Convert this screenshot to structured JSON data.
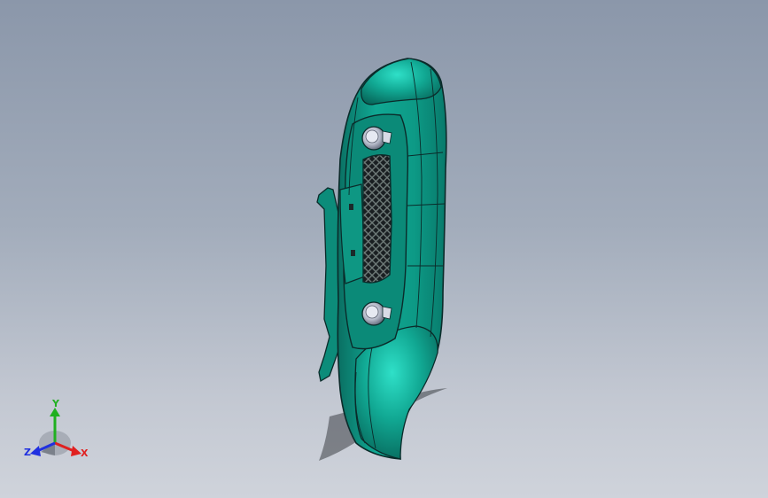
{
  "viewport": {
    "background_top": "#8b97aa",
    "background_bottom": "#cfd3db",
    "model_color": "#0e9b86",
    "model_edge_color": "#0b2b2a"
  },
  "triad": {
    "x_label": "X",
    "y_label": "Y",
    "z_label": "Z",
    "x_color": "#e02020",
    "y_color": "#20b020",
    "z_color": "#2030e0"
  }
}
